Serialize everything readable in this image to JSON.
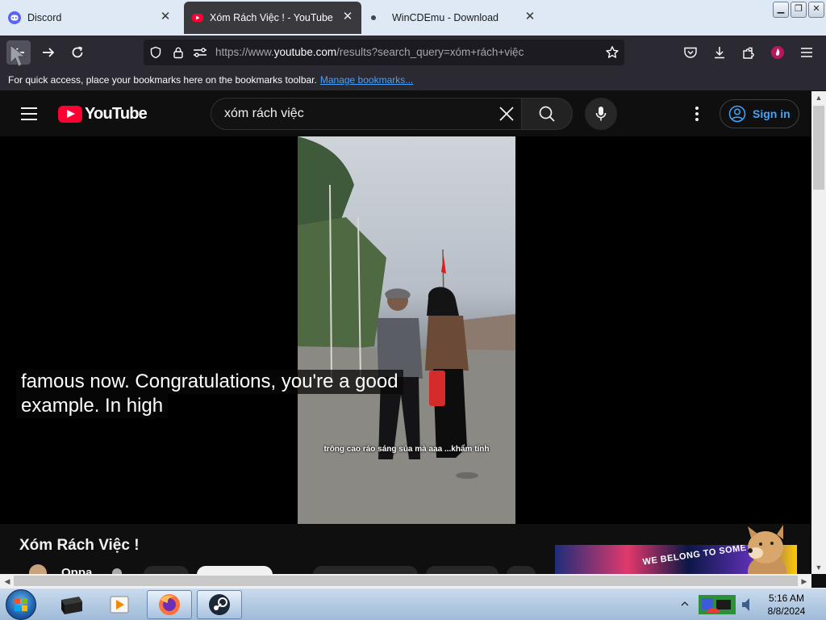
{
  "browser": {
    "tabs": [
      {
        "title": "Discord",
        "icon": "discord-icon",
        "active": false
      },
      {
        "title": "Xóm Rách Việc ! - YouTube",
        "icon": "youtube-icon",
        "active": true
      },
      {
        "title": "WinCDEmu - Download",
        "icon": "dot-icon",
        "active": false
      }
    ],
    "url": {
      "prefix": "https://www.",
      "host": "youtube.com",
      "path": "/results?search_query=xóm+rách+việc"
    },
    "bookmarks_bar": {
      "message": "For quick access, place your bookmarks here on the bookmarks toolbar.",
      "link": "Manage bookmarks..."
    }
  },
  "youtube": {
    "logo_text": "YouTube",
    "search": {
      "value": "xóm rách việc"
    },
    "sign_in": "Sign in",
    "captions": [
      "famous now. Congratulations, you're a good",
      "example.  In high"
    ],
    "burned_in_subtitle": "trông cao ráo sáng sủa mà aaa ...khẩm tính",
    "video_title": "Xóm Rách Việc !",
    "channel_name": "Oppa",
    "ad_text": "WE BELONG TO SOMETHING"
  },
  "taskbar": {
    "apps": [
      "black-box-app-icon",
      "media-player-icon",
      "firefox-icon",
      "steam-icon"
    ],
    "clock": {
      "time": "5:16 AM",
      "date": "8/8/2024"
    }
  },
  "colors": {
    "youtube_red": "#ff0033",
    "link_blue": "#3ea6ff",
    "tab_active": "#3a3a3e",
    "toolbar": "#2b2a33"
  }
}
